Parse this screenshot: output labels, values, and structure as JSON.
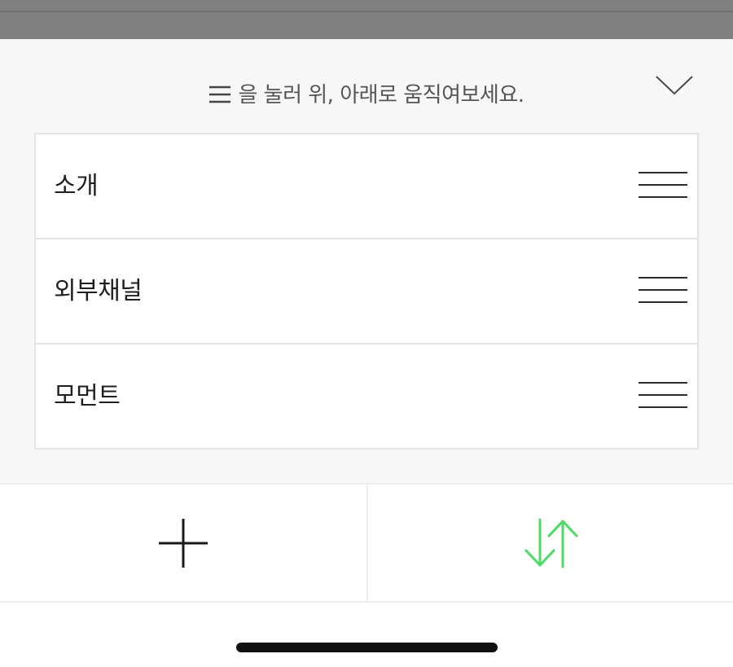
{
  "sheet": {
    "hint_text": "을 눌러 위, 아래로 움직여보세요.",
    "hint_icon": "drag-handle-icon",
    "collapse_icon": "chevron-down-icon"
  },
  "list": {
    "items": [
      {
        "label": "소개",
        "handle_icon": "drag-handle-icon"
      },
      {
        "label": "외부채널",
        "handle_icon": "drag-handle-icon"
      },
      {
        "label": "모먼트",
        "handle_icon": "drag-handle-icon"
      }
    ]
  },
  "toolbar": {
    "add_icon": "plus-icon",
    "reorder_icon": "sort-arrows-icon",
    "reorder_active_color": "#4cd964"
  }
}
